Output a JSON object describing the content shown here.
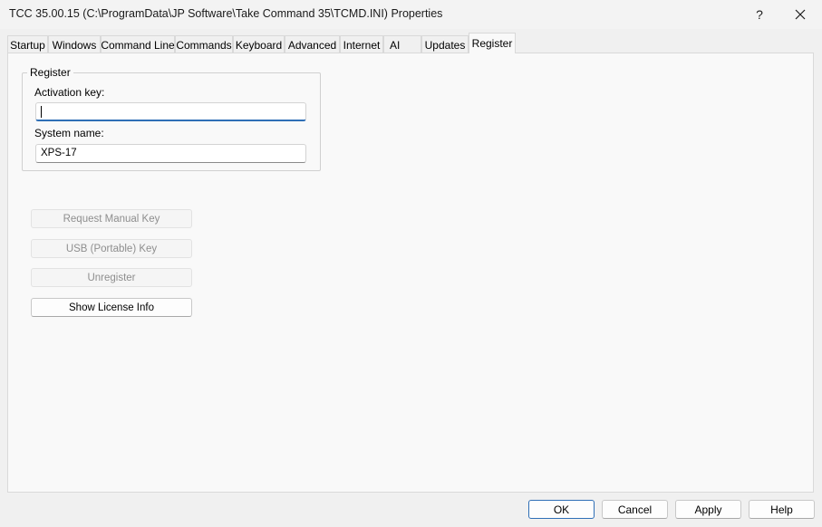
{
  "window": {
    "title": "TCC  35.00.15  (C:\\ProgramData\\JP Software\\Take Command 35\\TCMD.INI)  Properties",
    "help_label": "?",
    "close_icon": "close-icon"
  },
  "tabs": [
    {
      "label": "Startup"
    },
    {
      "label": "Windows"
    },
    {
      "label": "Command Line"
    },
    {
      "label": "Commands"
    },
    {
      "label": "Keyboard"
    },
    {
      "label": "Advanced"
    },
    {
      "label": "Internet"
    },
    {
      "label": "AI"
    },
    {
      "label": "Updates"
    },
    {
      "label": "Register",
      "active": true
    }
  ],
  "register": {
    "group_title": "Register",
    "activation_key_label": "Activation key:",
    "activation_key_value": "",
    "system_name_label": "System name:",
    "system_name_value": "XPS-17"
  },
  "actions": {
    "request_manual_key": "Request Manual Key",
    "usb_portable_key": "USB (Portable) Key",
    "unregister": "Unregister",
    "show_license_info": "Show License Info"
  },
  "footer": {
    "ok": "OK",
    "cancel": "Cancel",
    "apply": "Apply",
    "help": "Help"
  },
  "colors": {
    "accent": "#2f6fb6",
    "disabled_text": "#8e8e8e"
  }
}
